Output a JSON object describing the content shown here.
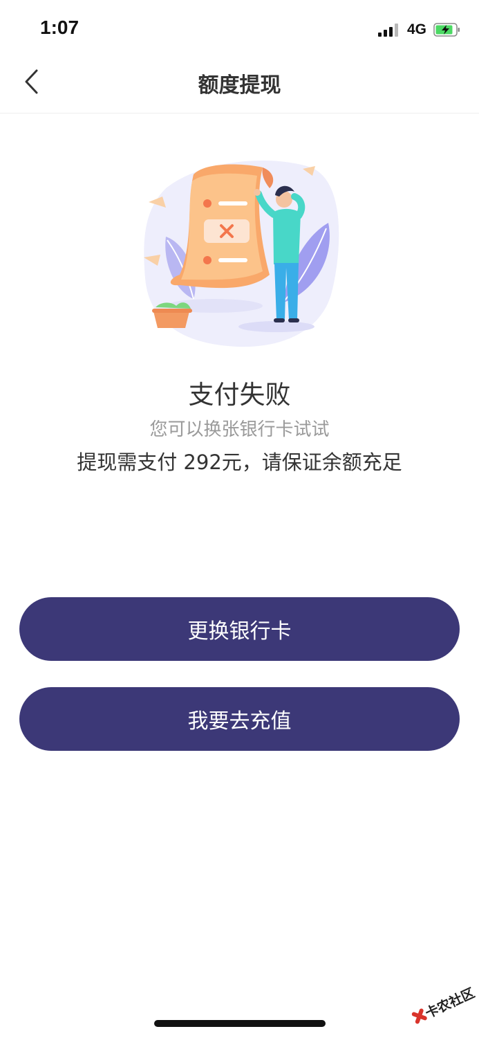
{
  "status_bar": {
    "time": "1:07",
    "network": "4G",
    "battery_color": "#4cd964"
  },
  "nav": {
    "title": "额度提现",
    "back_icon": "chevron-left-icon"
  },
  "result": {
    "title": "支付失败",
    "subtitle": "您可以换张银行卡试试",
    "note": "提现需支付 292元，请保证余额充足"
  },
  "buttons": {
    "change_card": "更换银行卡",
    "recharge": "我要去充值"
  },
  "colors": {
    "primary_button": "#3c3877",
    "accent_orange": "#f9a86a",
    "accent_purple": "#9e9df0"
  },
  "watermark": {
    "text": "卡农社区"
  }
}
